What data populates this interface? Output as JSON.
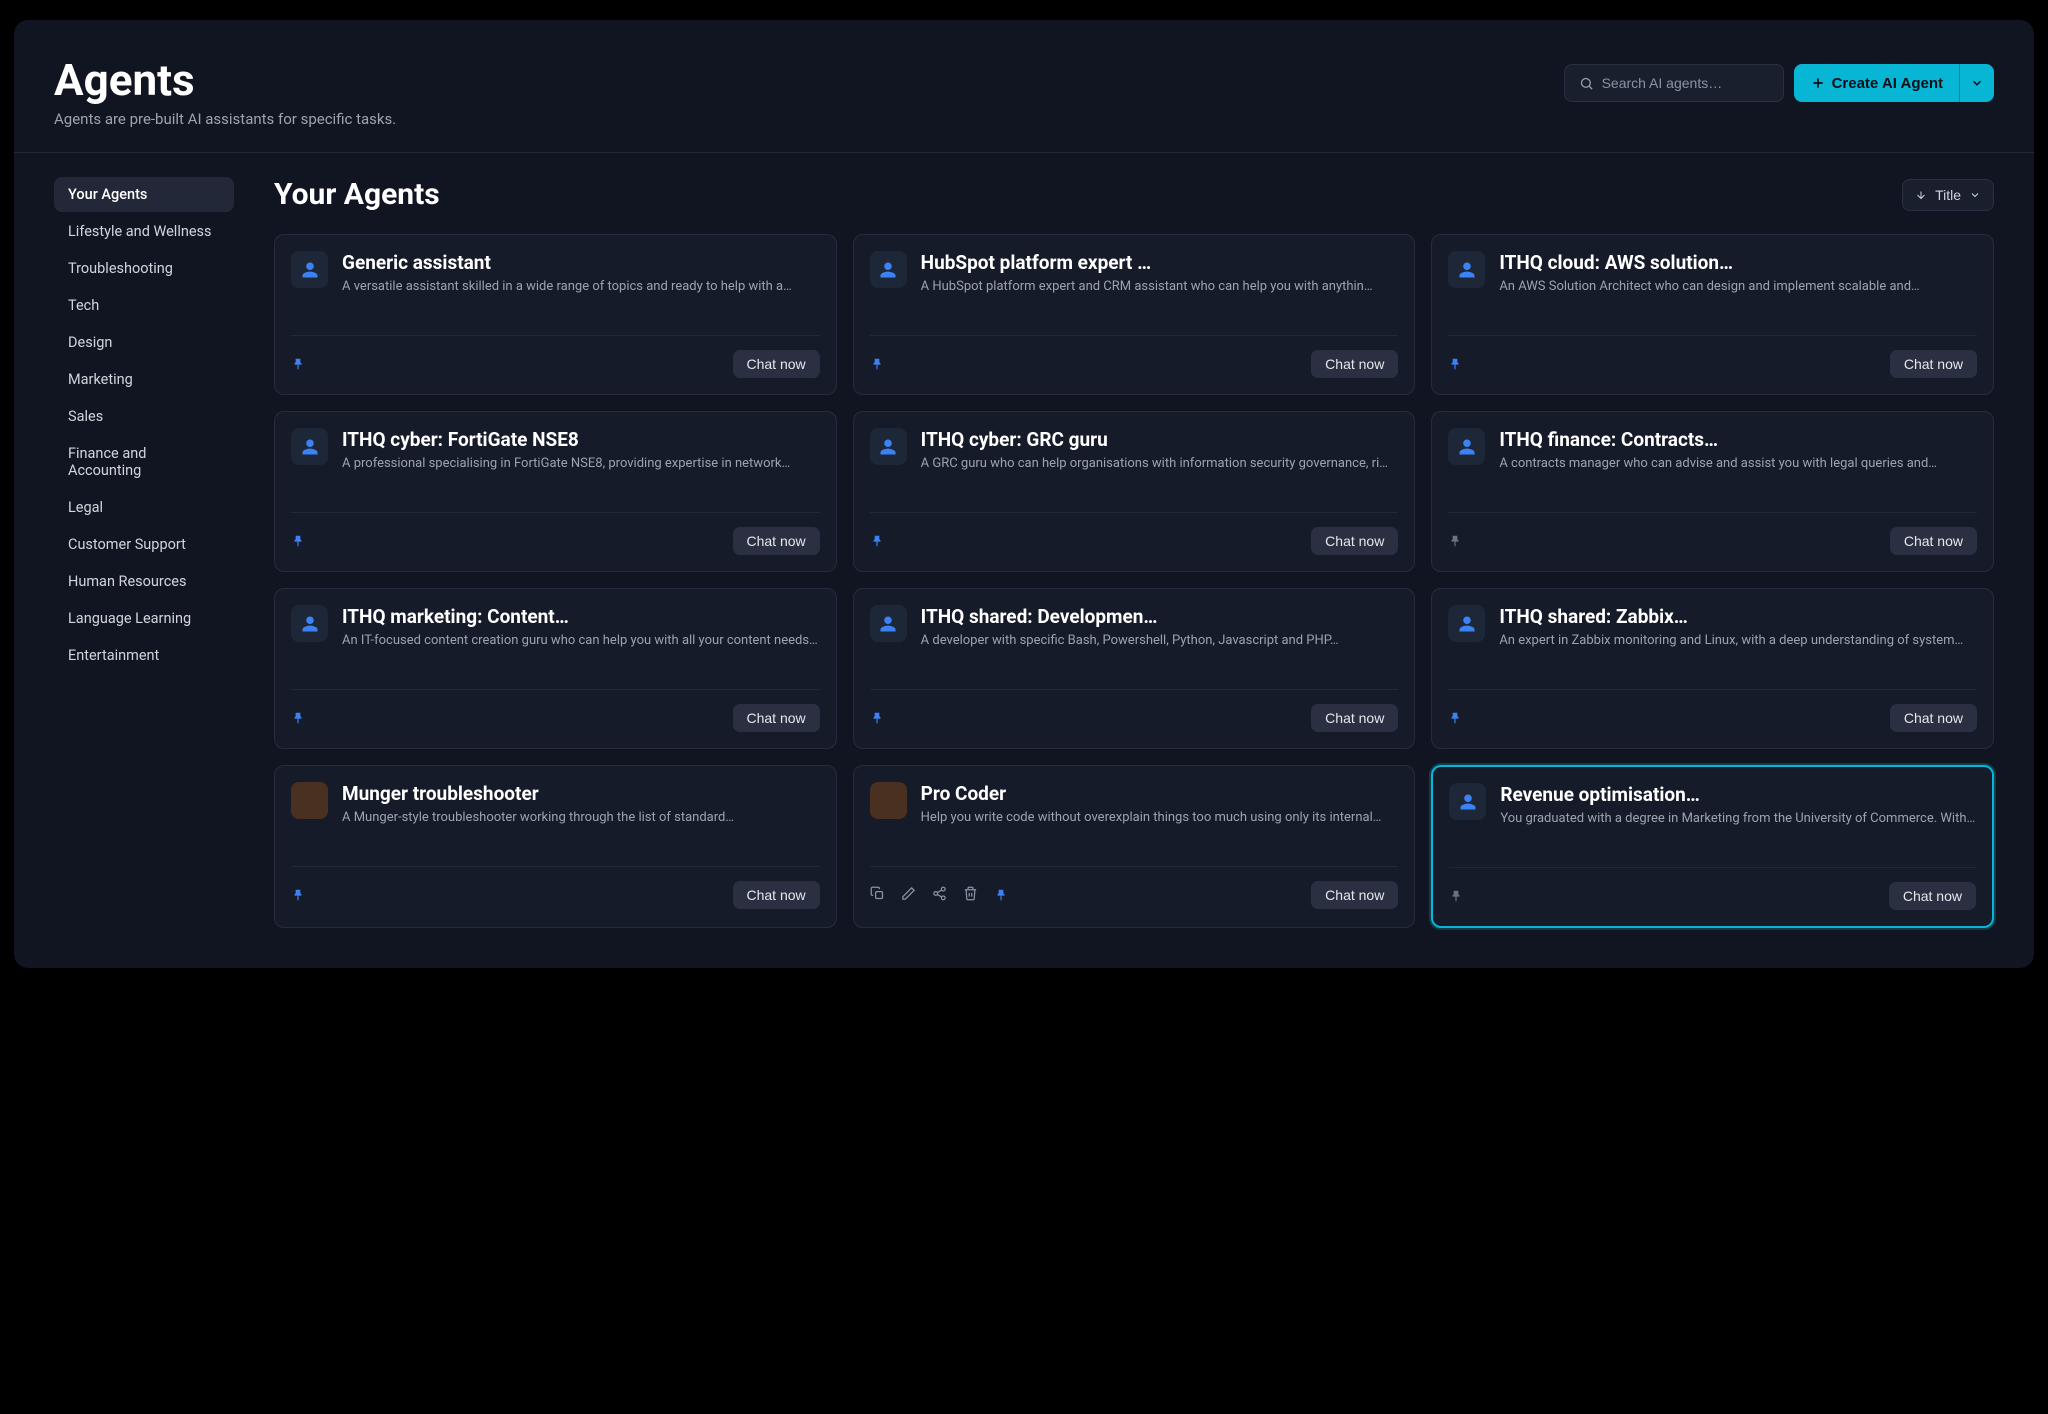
{
  "header": {
    "title": "Agents",
    "subtitle": "Agents are pre-built AI assistants for specific tasks.",
    "search_placeholder": "Search AI agents…",
    "create_label": "Create AI Agent"
  },
  "sidebar": {
    "items": [
      {
        "label": "Your Agents",
        "active": true
      },
      {
        "label": "Lifestyle and Wellness"
      },
      {
        "label": "Troubleshooting"
      },
      {
        "label": "Tech"
      },
      {
        "label": "Design"
      },
      {
        "label": "Marketing"
      },
      {
        "label": "Sales"
      },
      {
        "label": "Finance and Accounting"
      },
      {
        "label": "Legal"
      },
      {
        "label": "Customer Support"
      },
      {
        "label": "Human Resources"
      },
      {
        "label": "Language Learning"
      },
      {
        "label": "Entertainment"
      }
    ]
  },
  "main": {
    "heading": "Your Agents",
    "sort_label": "Title",
    "chat_label": "Chat now"
  },
  "agents": [
    {
      "title": "Generic assistant",
      "desc": "A versatile assistant skilled in a wide range of topics and ready to help with a…",
      "pinned": true
    },
    {
      "title": "HubSpot platform expert …",
      "desc": "A HubSpot platform expert and CRM assistant who can help you with anythin…",
      "pinned": true
    },
    {
      "title": "ITHQ cloud: AWS solution…",
      "desc": "An AWS Solution Architect who can design and implement scalable and…",
      "pinned": true
    },
    {
      "title": "ITHQ cyber: FortiGate NSE8",
      "desc": "A professional specialising in FortiGate NSE8, providing expertise in network…",
      "pinned": true
    },
    {
      "title": "ITHQ cyber: GRC guru",
      "desc": "A GRC guru who can help organisations with information security governance, ri…",
      "pinned": true
    },
    {
      "title": "ITHQ finance: Contracts…",
      "desc": "A contracts manager who can advise and assist you with legal queries and…",
      "pinned": false,
      "muted_pin": true
    },
    {
      "title": "ITHQ marketing: Content…",
      "desc": "An IT-focused content creation guru who can help you with all your content needs…",
      "pinned": true
    },
    {
      "title": "ITHQ shared: Developmen…",
      "desc": "A developer with specific Bash, Powershell, Python, Javascript and PHP…",
      "pinned": true
    },
    {
      "title": "ITHQ shared: Zabbix…",
      "desc": "An expert in Zabbix monitoring and Linux, with a deep understanding of system…",
      "pinned": true
    },
    {
      "title": "Munger troubleshooter",
      "desc": "A Munger-style troubleshooter working through the list of standard…",
      "pinned": true,
      "avatar_image": true
    },
    {
      "title": "Pro Coder",
      "desc": "Help you write code without overexplain things too much using only its internal…",
      "pinned": true,
      "avatar_image": true,
      "show_actions": true
    },
    {
      "title": "Revenue optimisation…",
      "desc": "You graduated with a degree in Marketing from the University of Commerce. With…",
      "pinned": false,
      "muted_pin": true,
      "selected": true
    }
  ]
}
